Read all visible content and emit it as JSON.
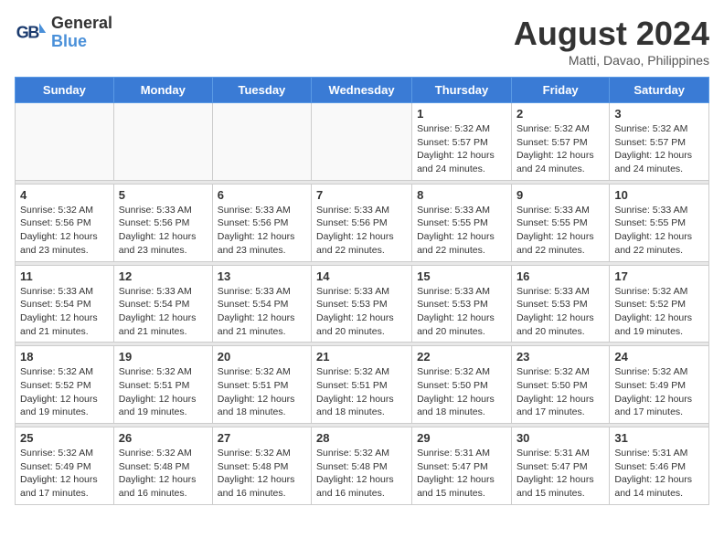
{
  "header": {
    "logo_line1": "General",
    "logo_line2": "Blue",
    "month_year": "August 2024",
    "location": "Matti, Davao, Philippines"
  },
  "weekdays": [
    "Sunday",
    "Monday",
    "Tuesday",
    "Wednesday",
    "Thursday",
    "Friday",
    "Saturday"
  ],
  "weeks": [
    [
      {
        "day": "",
        "info": ""
      },
      {
        "day": "",
        "info": ""
      },
      {
        "day": "",
        "info": ""
      },
      {
        "day": "",
        "info": ""
      },
      {
        "day": "1",
        "info": "Sunrise: 5:32 AM\nSunset: 5:57 PM\nDaylight: 12 hours\nand 24 minutes."
      },
      {
        "day": "2",
        "info": "Sunrise: 5:32 AM\nSunset: 5:57 PM\nDaylight: 12 hours\nand 24 minutes."
      },
      {
        "day": "3",
        "info": "Sunrise: 5:32 AM\nSunset: 5:57 PM\nDaylight: 12 hours\nand 24 minutes."
      }
    ],
    [
      {
        "day": "4",
        "info": "Sunrise: 5:32 AM\nSunset: 5:56 PM\nDaylight: 12 hours\nand 23 minutes."
      },
      {
        "day": "5",
        "info": "Sunrise: 5:33 AM\nSunset: 5:56 PM\nDaylight: 12 hours\nand 23 minutes."
      },
      {
        "day": "6",
        "info": "Sunrise: 5:33 AM\nSunset: 5:56 PM\nDaylight: 12 hours\nand 23 minutes."
      },
      {
        "day": "7",
        "info": "Sunrise: 5:33 AM\nSunset: 5:56 PM\nDaylight: 12 hours\nand 22 minutes."
      },
      {
        "day": "8",
        "info": "Sunrise: 5:33 AM\nSunset: 5:55 PM\nDaylight: 12 hours\nand 22 minutes."
      },
      {
        "day": "9",
        "info": "Sunrise: 5:33 AM\nSunset: 5:55 PM\nDaylight: 12 hours\nand 22 minutes."
      },
      {
        "day": "10",
        "info": "Sunrise: 5:33 AM\nSunset: 5:55 PM\nDaylight: 12 hours\nand 22 minutes."
      }
    ],
    [
      {
        "day": "11",
        "info": "Sunrise: 5:33 AM\nSunset: 5:54 PM\nDaylight: 12 hours\nand 21 minutes."
      },
      {
        "day": "12",
        "info": "Sunrise: 5:33 AM\nSunset: 5:54 PM\nDaylight: 12 hours\nand 21 minutes."
      },
      {
        "day": "13",
        "info": "Sunrise: 5:33 AM\nSunset: 5:54 PM\nDaylight: 12 hours\nand 21 minutes."
      },
      {
        "day": "14",
        "info": "Sunrise: 5:33 AM\nSunset: 5:53 PM\nDaylight: 12 hours\nand 20 minutes."
      },
      {
        "day": "15",
        "info": "Sunrise: 5:33 AM\nSunset: 5:53 PM\nDaylight: 12 hours\nand 20 minutes."
      },
      {
        "day": "16",
        "info": "Sunrise: 5:33 AM\nSunset: 5:53 PM\nDaylight: 12 hours\nand 20 minutes."
      },
      {
        "day": "17",
        "info": "Sunrise: 5:32 AM\nSunset: 5:52 PM\nDaylight: 12 hours\nand 19 minutes."
      }
    ],
    [
      {
        "day": "18",
        "info": "Sunrise: 5:32 AM\nSunset: 5:52 PM\nDaylight: 12 hours\nand 19 minutes."
      },
      {
        "day": "19",
        "info": "Sunrise: 5:32 AM\nSunset: 5:51 PM\nDaylight: 12 hours\nand 19 minutes."
      },
      {
        "day": "20",
        "info": "Sunrise: 5:32 AM\nSunset: 5:51 PM\nDaylight: 12 hours\nand 18 minutes."
      },
      {
        "day": "21",
        "info": "Sunrise: 5:32 AM\nSunset: 5:51 PM\nDaylight: 12 hours\nand 18 minutes."
      },
      {
        "day": "22",
        "info": "Sunrise: 5:32 AM\nSunset: 5:50 PM\nDaylight: 12 hours\nand 18 minutes."
      },
      {
        "day": "23",
        "info": "Sunrise: 5:32 AM\nSunset: 5:50 PM\nDaylight: 12 hours\nand 17 minutes."
      },
      {
        "day": "24",
        "info": "Sunrise: 5:32 AM\nSunset: 5:49 PM\nDaylight: 12 hours\nand 17 minutes."
      }
    ],
    [
      {
        "day": "25",
        "info": "Sunrise: 5:32 AM\nSunset: 5:49 PM\nDaylight: 12 hours\nand 17 minutes."
      },
      {
        "day": "26",
        "info": "Sunrise: 5:32 AM\nSunset: 5:48 PM\nDaylight: 12 hours\nand 16 minutes."
      },
      {
        "day": "27",
        "info": "Sunrise: 5:32 AM\nSunset: 5:48 PM\nDaylight: 12 hours\nand 16 minutes."
      },
      {
        "day": "28",
        "info": "Sunrise: 5:32 AM\nSunset: 5:48 PM\nDaylight: 12 hours\nand 16 minutes."
      },
      {
        "day": "29",
        "info": "Sunrise: 5:31 AM\nSunset: 5:47 PM\nDaylight: 12 hours\nand 15 minutes."
      },
      {
        "day": "30",
        "info": "Sunrise: 5:31 AM\nSunset: 5:47 PM\nDaylight: 12 hours\nand 15 minutes."
      },
      {
        "day": "31",
        "info": "Sunrise: 5:31 AM\nSunset: 5:46 PM\nDaylight: 12 hours\nand 14 minutes."
      }
    ]
  ]
}
